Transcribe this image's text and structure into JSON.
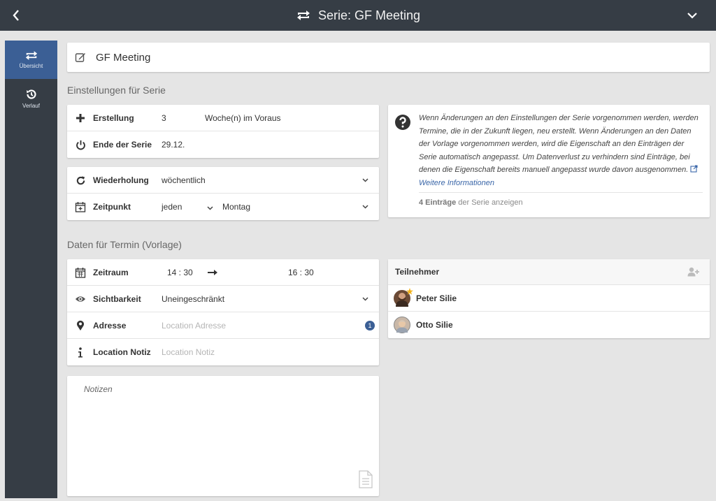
{
  "header": {
    "title": "Serie: GF Meeting"
  },
  "sidenav": {
    "items": [
      {
        "label": "Übersicht"
      },
      {
        "label": "Verlauf"
      }
    ]
  },
  "series": {
    "name": "GF Meeting"
  },
  "settings": {
    "heading": "Einstellungen für Serie",
    "creation": {
      "label": "Erstellung",
      "value": "3",
      "unit": "Woche(n) im Voraus"
    },
    "end": {
      "label": "Ende der Serie",
      "value": "29.12."
    },
    "repeat": {
      "label": "Wiederholung",
      "value": "wöchentlich"
    },
    "time": {
      "label": "Zeitpunkt",
      "mode": "jeden",
      "day": "Montag"
    }
  },
  "info": {
    "text": "Wenn Änderungen an den Einstellungen der Serie vorgenommen werden, werden Termine, die in der Zukunft liegen, neu erstellt. Wenn Änderungen an den Daten der Vorlage vorgenommen werden, wird die Eigenschaft an den Einträgen der Serie automatisch angepasst. Um Datenverlust zu verhindern sind Einträge, bei denen die Eigenschaft bereits manuell angepasst wurde davon ausgenommen.",
    "link": "Weitere Informationen",
    "count_bold": "4 Einträge",
    "count_rest": "der Serie anzeigen"
  },
  "template": {
    "heading": "Daten für Termin (Vorlage)",
    "period": {
      "label": "Zeitraum",
      "from": "14 : 30",
      "to": "16 : 30"
    },
    "visibility": {
      "label": "Sichtbarkeit",
      "value": "Uneingeschränkt"
    },
    "address": {
      "label": "Adresse",
      "placeholder": "Location Adresse",
      "badge": "1"
    },
    "location_note": {
      "label": "Location Notiz",
      "placeholder": "Location Notiz"
    },
    "notes_placeholder": "Notizen"
  },
  "participants": {
    "heading": "Teilnehmer",
    "people": [
      {
        "name": "Peter Silie",
        "avatar_color": "#6b4a35"
      },
      {
        "name": "Otto Silie",
        "avatar_color": "#c9b8a8"
      }
    ]
  }
}
